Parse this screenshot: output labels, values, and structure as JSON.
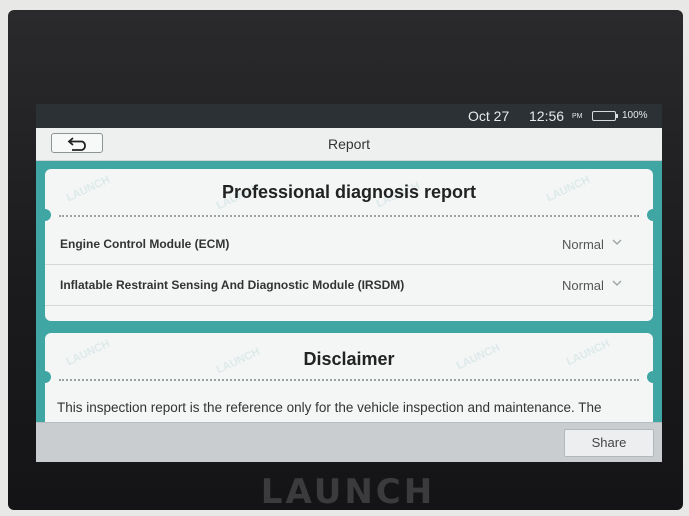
{
  "device": {
    "brand_label": "LAUNCH"
  },
  "status_bar": {
    "date": "Oct 27",
    "time": "12:56",
    "ampm": "PM",
    "battery": "100%",
    "battery_level": 1.0,
    "battery_color": "#3fd13f"
  },
  "header": {
    "back_icon": "back-arrow-icon",
    "title": "Report"
  },
  "report": {
    "heading": "Professional diagnosis report",
    "watermark": "LAUNCH",
    "modules": [
      {
        "name": "Engine Control Module (ECM)",
        "status": "Normal"
      },
      {
        "name": "Inflatable Restraint Sensing And Diagnostic Module (IRSDM)",
        "status": "Normal"
      }
    ]
  },
  "disclaimer": {
    "heading": "Disclaimer",
    "text": "This inspection report is the reference only for the vehicle inspection and maintenance. The"
  },
  "footer": {
    "share_label": "Share"
  },
  "colors": {
    "accent": "#3fa6a4",
    "status_bar": "#2b3134",
    "card": "#f4f6f6"
  }
}
